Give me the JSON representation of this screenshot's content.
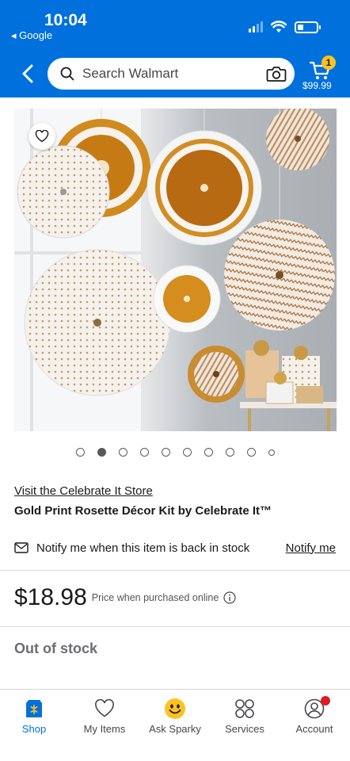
{
  "status_bar": {
    "time": "10:04",
    "back_app": "◂ Google"
  },
  "header": {
    "search_placeholder": "Search Walmart",
    "cart_count": "1",
    "cart_total": "$99.99",
    "brand_color": "#0071dc",
    "icons": [
      "back-chevron-icon",
      "search-icon",
      "camera-icon",
      "cart-icon"
    ]
  },
  "product": {
    "image_alt": "Gold Print Rosette Décor Kit paper fans",
    "carousel": {
      "total": 10,
      "active_index": 1
    },
    "store_link": "Visit the Celebrate It Store",
    "title": "Gold Print Rosette Décor Kit by Celebrate It™",
    "notify_text": "Notify me when this item is back in stock",
    "notify_link": "Notify me",
    "price": "$18.98",
    "price_note": "Price when purchased online",
    "availability": "Out of stock"
  },
  "bottom_nav": {
    "items": [
      {
        "label": "Shop",
        "icon": "shop-icon",
        "active": true
      },
      {
        "label": "My Items",
        "icon": "heart-icon",
        "active": false
      },
      {
        "label": "Ask Sparky",
        "icon": "sparky-icon",
        "active": false
      },
      {
        "label": "Services",
        "icon": "services-icon",
        "active": false
      },
      {
        "label": "Account",
        "icon": "account-icon",
        "active": false
      }
    ]
  },
  "colors": {
    "accent": "#0071dc",
    "badge": "#ffc220",
    "notification": "#de1c24"
  }
}
